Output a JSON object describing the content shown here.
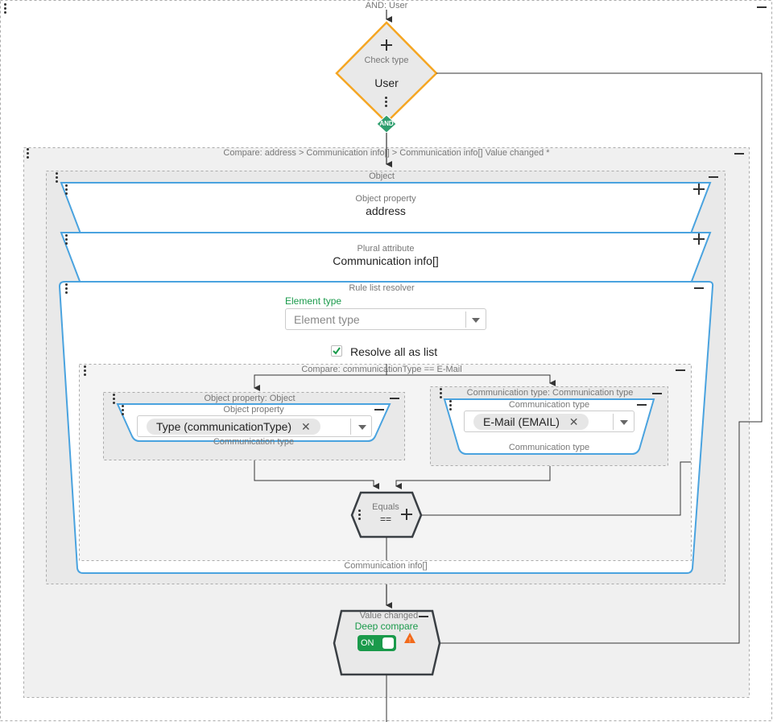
{
  "root": {
    "title": "AND: User"
  },
  "check_node": {
    "caption": "Check type",
    "value": "User",
    "and_badge": "AND"
  },
  "compare_group": {
    "title": "Compare: address > Communication info[] > Communication info[] Value changed *"
  },
  "object_group": {
    "title": "Object"
  },
  "object_property": {
    "caption": "Object property",
    "value": "address"
  },
  "plural_attribute": {
    "caption": "Plural attribute",
    "value": "Communication info[]"
  },
  "rule_list_resolver": {
    "caption": "Rule list resolver",
    "element_type_label": "Element type",
    "element_type_placeholder": "Element type",
    "resolve_all_label": "Resolve all as list",
    "resolve_all_checked": true,
    "footer": "Communication info[]"
  },
  "inner_compare": {
    "title": "Compare: communicationType == E-Mail"
  },
  "left_group": {
    "title": "Object property: Object",
    "caption": "Object property",
    "chip": "Type (communicationType)",
    "footer": "Communication type"
  },
  "right_group": {
    "title": "Communication type: Communication type",
    "caption": "Communication type",
    "chip": "E-Mail (EMAIL)",
    "footer": "Communication type"
  },
  "equals_node": {
    "caption": "Equals",
    "value": "=="
  },
  "value_changed": {
    "caption": "Value changed",
    "deep_compare_label": "Deep compare",
    "toggle_label": "ON",
    "toggle_on": true
  },
  "colors": {
    "blue": "#4aa3df",
    "orange": "#f5a623",
    "green": "#1a9a4b",
    "dark": "#3a3f44",
    "warning": "#f26a1b"
  }
}
